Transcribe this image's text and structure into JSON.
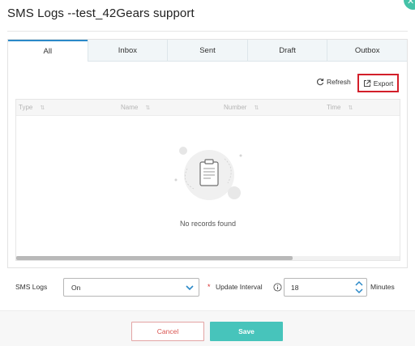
{
  "dialog": {
    "title": "SMS Logs --test_42Gears support",
    "close_icon": "close-icon",
    "accent_color": "#45c2a8"
  },
  "tabs": [
    {
      "label": "All",
      "active": true
    },
    {
      "label": "Inbox",
      "active": false
    },
    {
      "label": "Sent",
      "active": false
    },
    {
      "label": "Draft",
      "active": false
    },
    {
      "label": "Outbox",
      "active": false
    }
  ],
  "toolbar": {
    "refresh_label": "Refresh",
    "refresh_icon": "refresh-icon",
    "export_label": "Export",
    "export_icon": "external-link-icon",
    "highlight_color": "#d31f2a"
  },
  "table": {
    "columns": [
      "Type",
      "Name",
      "Number",
      "Time"
    ],
    "empty_message": "No records found",
    "scroll_fraction": 0.72
  },
  "settings": {
    "sms_logs_label": "SMS Logs",
    "sms_logs_value": "On",
    "update_interval_label": "Update Interval",
    "update_interval_value": "18",
    "minutes_label": "Minutes"
  },
  "footer": {
    "cancel_label": "Cancel",
    "save_label": "Save",
    "save_color": "#47c4bb",
    "cancel_color": "#d9534f"
  }
}
